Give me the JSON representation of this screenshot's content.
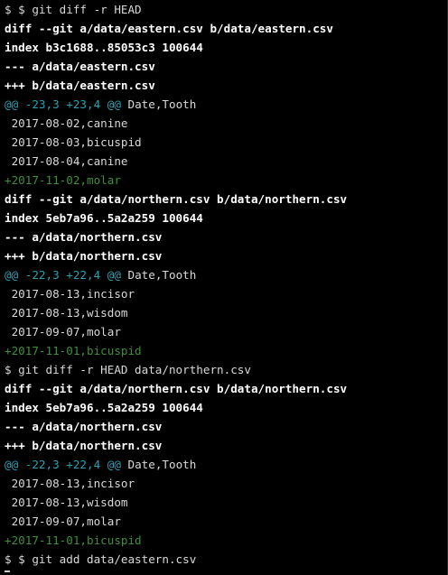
{
  "colors": {
    "background": "#000000",
    "text": "#d8d8d8",
    "bold_text": "#ffffff",
    "hunk_header": "#2aa1b3",
    "added_line": "#3f8f3a"
  },
  "terminal": {
    "lines": [
      {
        "kind": "prompt",
        "text": "$ $ git diff -r HEAD"
      },
      {
        "kind": "meta",
        "text": "diff --git a/data/eastern.csv b/data/eastern.csv"
      },
      {
        "kind": "meta",
        "text": "index b3c1688..85053c3 100644"
      },
      {
        "kind": "meta",
        "text": "--- a/data/eastern.csv"
      },
      {
        "kind": "meta",
        "text": "+++ b/data/eastern.csv"
      },
      {
        "kind": "hunk",
        "marker": "@@ -23,3 +23,4 @@",
        "context": " Date,Tooth"
      },
      {
        "kind": "context",
        "text": " 2017-08-02,canine"
      },
      {
        "kind": "context",
        "text": " 2017-08-03,bicuspid"
      },
      {
        "kind": "context",
        "text": " 2017-08-04,canine"
      },
      {
        "kind": "added",
        "text": "+2017-11-02,molar"
      },
      {
        "kind": "meta",
        "text": "diff --git a/data/northern.csv b/data/northern.csv"
      },
      {
        "kind": "meta",
        "text": "index 5eb7a96..5a2a259 100644"
      },
      {
        "kind": "meta",
        "text": "--- a/data/northern.csv"
      },
      {
        "kind": "meta",
        "text": "+++ b/data/northern.csv"
      },
      {
        "kind": "hunk",
        "marker": "@@ -22,3 +22,4 @@",
        "context": " Date,Tooth"
      },
      {
        "kind": "context",
        "text": " 2017-08-13,incisor"
      },
      {
        "kind": "context",
        "text": " 2017-08-13,wisdom"
      },
      {
        "kind": "context",
        "text": " 2017-09-07,molar"
      },
      {
        "kind": "added",
        "text": "+2017-11-01,bicuspid"
      },
      {
        "kind": "prompt",
        "text": "$ git diff -r HEAD data/northern.csv"
      },
      {
        "kind": "meta",
        "text": "diff --git a/data/northern.csv b/data/northern.csv"
      },
      {
        "kind": "meta",
        "text": "index 5eb7a96..5a2a259 100644"
      },
      {
        "kind": "meta",
        "text": "--- a/data/northern.csv"
      },
      {
        "kind": "meta",
        "text": "+++ b/data/northern.csv"
      },
      {
        "kind": "hunk",
        "marker": "@@ -22,3 +22,4 @@",
        "context": " Date,Tooth"
      },
      {
        "kind": "context",
        "text": " 2017-08-13,incisor"
      },
      {
        "kind": "context",
        "text": " 2017-08-13,wisdom"
      },
      {
        "kind": "context",
        "text": " 2017-09-07,molar"
      },
      {
        "kind": "added",
        "text": "+2017-11-01,bicuspid"
      },
      {
        "kind": "prompt",
        "text": "$ $ git add data/eastern.csv"
      }
    ]
  }
}
